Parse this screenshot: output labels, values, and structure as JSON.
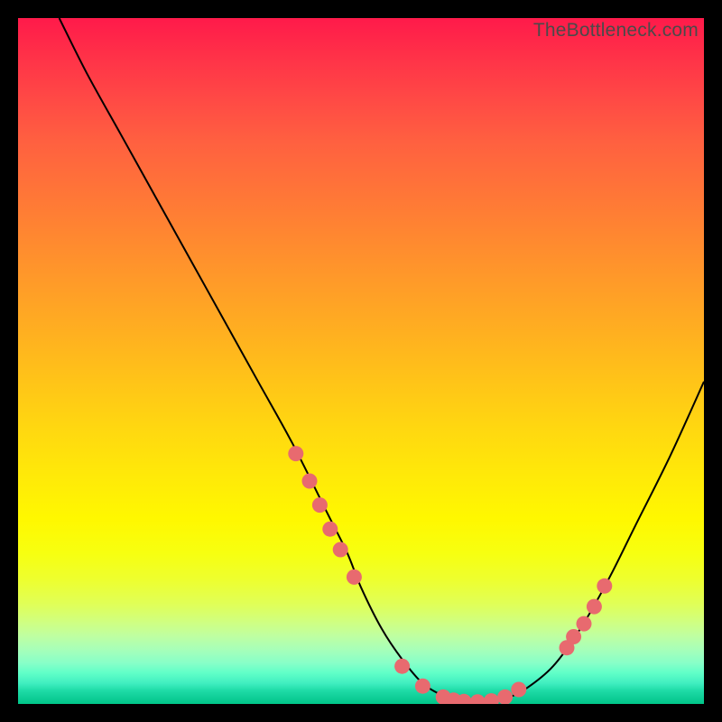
{
  "watermark": "TheBottleneck.com",
  "chart_data": {
    "type": "line",
    "title": "",
    "xlabel": "",
    "ylabel": "",
    "x_range": [
      0,
      100
    ],
    "y_range": [
      0,
      100
    ],
    "series": [
      {
        "name": "curve",
        "x": [
          6,
          10,
          15,
          20,
          25,
          30,
          35,
          40,
          45,
          48,
          50,
          53,
          56,
          59,
          62,
          65,
          68,
          71,
          74,
          78,
          82,
          86,
          90,
          95,
          100
        ],
        "y": [
          100,
          92,
          83,
          74,
          65,
          56,
          47,
          38,
          28,
          22,
          17,
          11,
          6.5,
          3,
          1.2,
          0.4,
          0.3,
          0.8,
          2.2,
          5.5,
          11,
          18,
          26,
          36,
          47
        ]
      }
    ],
    "markers": {
      "name": "highlighted-points",
      "color": "#e86a6f",
      "x": [
        40.5,
        42.5,
        44,
        45.5,
        47,
        49,
        56,
        59,
        62,
        63.5,
        65,
        67,
        69,
        71,
        73,
        80,
        81,
        82.5,
        84,
        85.5
      ],
      "y": [
        36.5,
        32.5,
        29,
        25.5,
        22.5,
        18.5,
        5.5,
        2.6,
        1.0,
        0.55,
        0.35,
        0.3,
        0.45,
        1.0,
        2.1,
        8.2,
        9.8,
        11.7,
        14.2,
        17.2
      ]
    },
    "gradient_note": "vertical heat gradient red→yellow→green (qualitative background)"
  }
}
